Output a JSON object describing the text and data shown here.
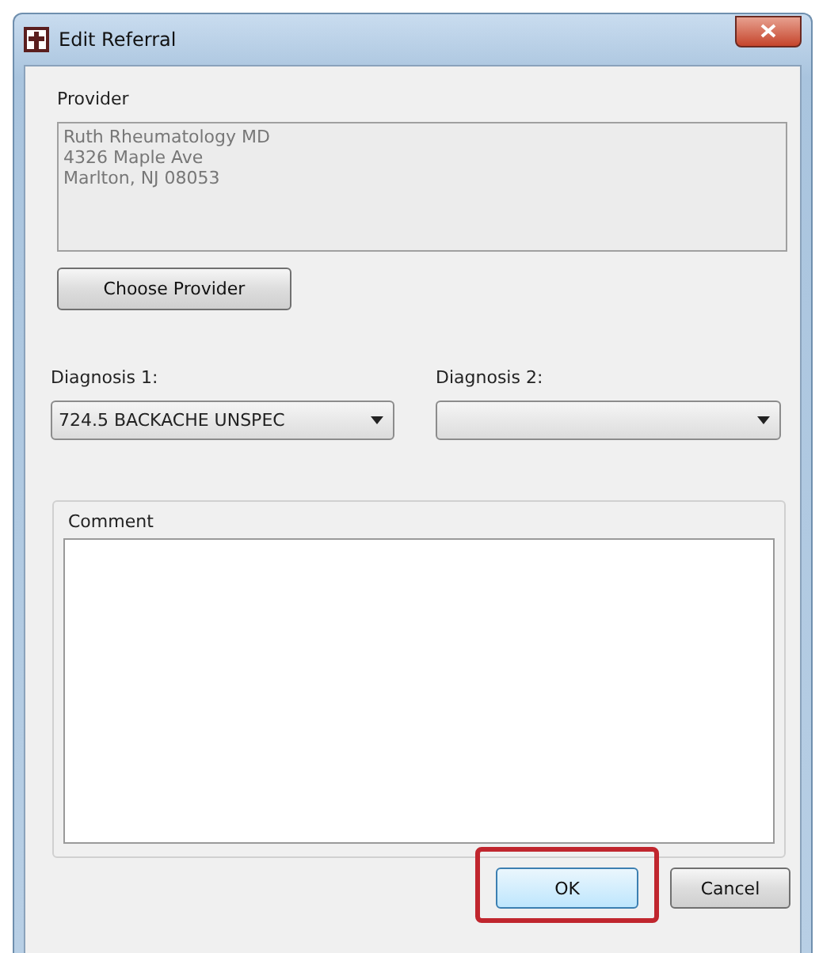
{
  "window": {
    "title": "Edit Referral"
  },
  "provider": {
    "label": "Provider",
    "lines": [
      "Ruth Rheumatology MD",
      "4326 Maple Ave",
      "Marlton, NJ 08053"
    ],
    "disabled": true,
    "button": "Choose Provider"
  },
  "diagnoses": [
    {
      "label": "Diagnosis 1:",
      "value": "724.5 BACKACHE UNSPEC"
    },
    {
      "label": "Diagnosis 2:"
    }
  ],
  "comment": {
    "label": "Comment"
  },
  "buttons": [
    {
      "label": "OK",
      "highlighted": true
    },
    {
      "label": "Cancel",
      "highlighted": false
    }
  ]
}
